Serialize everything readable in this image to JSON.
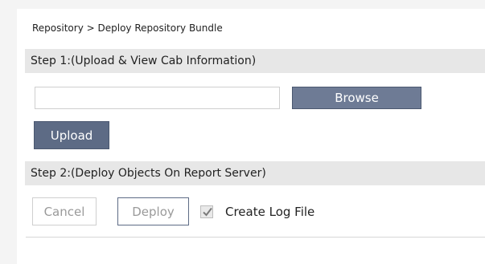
{
  "breadcrumb": {
    "text": "Repository > Deploy Repository Bundle"
  },
  "step1": {
    "title": "Step 1:(Upload & View Cab Information)",
    "file_value": "",
    "browse_label": "Browse",
    "upload_label": "Upload"
  },
  "step2": {
    "title": "Step 2:(Deploy Objects On Report Server)",
    "cancel_label": "Cancel",
    "deploy_label": "Deploy",
    "log_label": "Create Log File",
    "log_checked": true
  },
  "colors": {
    "primary_button": "#5d6b85",
    "section_header": "#e7e7e7"
  },
  "icons": {
    "checkbox": "checkmark-icon"
  }
}
